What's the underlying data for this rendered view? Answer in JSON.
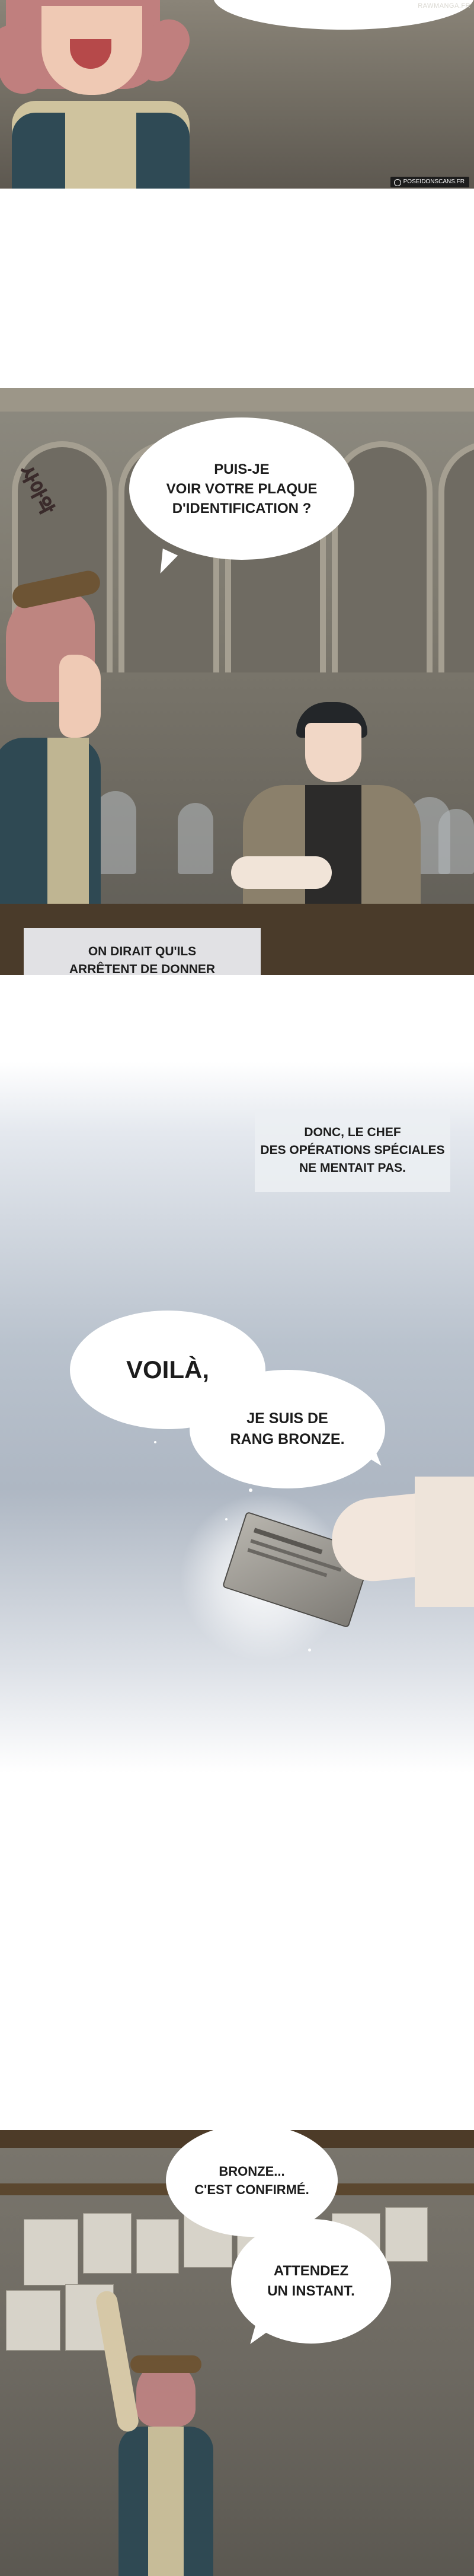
{
  "watermark": "RAWMANGA.FR",
  "badge": "POSEIDONSCANS.FR",
  "panel2": {
    "bubble": "PUIS-JE\nVOIR VOTRE PLAQUE\nD'IDENTIFICATION ?",
    "sfx": "사아악",
    "narration": "ON DIRAIT QU'ILS\nARRÊTENT DE DONNER\nN'IMPORTE QUELLE QUÊTE\nÀ N'IMPORTE QUI..."
  },
  "panel3": {
    "narration": "DONC, LE CHEF\nDES OPÉRATIONS SPÉCIALES\nNE MENTAIT PAS.",
    "bubble1": "VOILÀ,",
    "bubble2": "JE SUIS DE\nRANG BRONZE."
  },
  "panel4": {
    "bubble1": "BRONZE...\nC'EST CONFIRMÉ.",
    "bubble2": "ATTENDEZ\nUN INSTANT."
  }
}
